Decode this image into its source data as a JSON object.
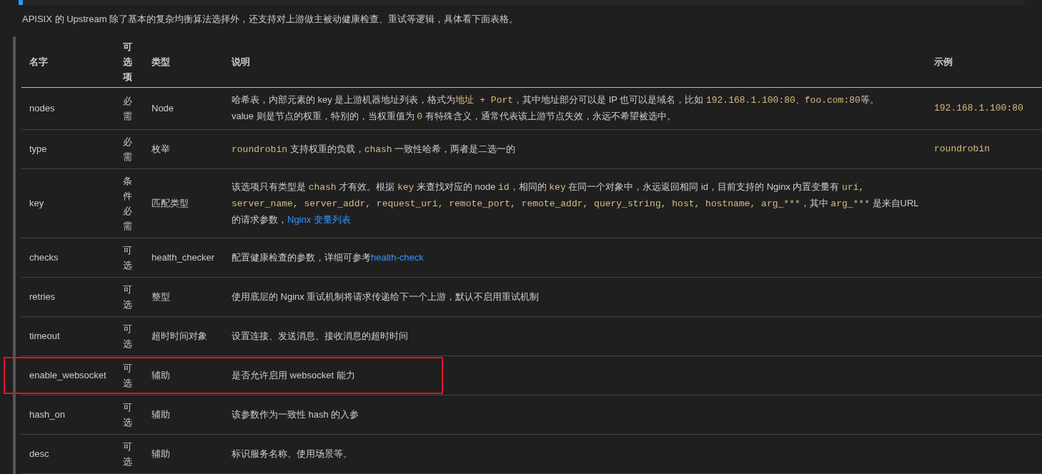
{
  "intro": "APISIX 的 Upstream 除了基本的复杂均衡算法选择外，还支持对上游做主被动健康检查、重试等逻辑，具体看下面表格。",
  "table": {
    "columns": [
      "名字",
      "可选项",
      "类型",
      "说明",
      "示例"
    ],
    "rows": [
      {
        "name": "nodes",
        "option": "必需",
        "type": "Node",
        "highlighted": false,
        "description": [
          [
            {
              "kind": "text",
              "text": "哈希表，内部元素的 key 是上游机器地址列表，格式为"
            },
            {
              "kind": "code",
              "text": "地址 + Port"
            },
            {
              "kind": "text",
              "text": "，其中地址部分可以是 IP 也可以是域名，比如 "
            },
            {
              "kind": "code",
              "text": "192.168.1.100:80"
            },
            {
              "kind": "text",
              "text": "、"
            },
            {
              "kind": "code",
              "text": "foo.com:80"
            },
            {
              "kind": "text",
              "text": "等。"
            }
          ],
          [
            {
              "kind": "text",
              "text": "value 则是节点的权重，特别的，当权重值为 "
            },
            {
              "kind": "code",
              "text": "0"
            },
            {
              "kind": "text",
              "text": " 有特殊含义，通常代表该上游节点失效，永远不希望被选中。"
            }
          ]
        ],
        "example": "192.168.1.100:80"
      },
      {
        "name": "type",
        "option": "必需",
        "type": "枚举",
        "highlighted": false,
        "description": [
          [
            {
              "kind": "code",
              "text": "roundrobin"
            },
            {
              "kind": "text",
              "text": " 支持权重的负载，"
            },
            {
              "kind": "code",
              "text": "chash"
            },
            {
              "kind": "text",
              "text": " 一致性哈希，两者是二选一的"
            }
          ]
        ],
        "example": "roundrobin"
      },
      {
        "name": "key",
        "option": "条件必需",
        "type": "匹配类型",
        "highlighted": false,
        "description": [
          [
            {
              "kind": "text",
              "text": "该选项只有类型是 "
            },
            {
              "kind": "code",
              "text": "chash"
            },
            {
              "kind": "text",
              "text": " 才有效。根据 "
            },
            {
              "kind": "code",
              "text": "key"
            },
            {
              "kind": "text",
              "text": " 来查找对应的 node "
            },
            {
              "kind": "code",
              "text": "id"
            },
            {
              "kind": "text",
              "text": "，相同的 "
            },
            {
              "kind": "code",
              "text": "key"
            },
            {
              "kind": "text",
              "text": " 在同一个对象中，永远返回相同 id，目前支持的 Nginx 内置变量有 "
            },
            {
              "kind": "code",
              "text": "uri,"
            }
          ],
          [
            {
              "kind": "code",
              "text": "server_name, server_addr, request_uri, remote_port, remote_addr, query_string, host, hostname, arg_***"
            },
            {
              "kind": "text",
              "text": "，其中 "
            },
            {
              "kind": "code",
              "text": "arg_***"
            },
            {
              "kind": "text",
              "text": " 是来自URL"
            }
          ],
          [
            {
              "kind": "text",
              "text": "的请求参数，"
            },
            {
              "kind": "link",
              "text": "Nginx 变量列表"
            }
          ]
        ]
      },
      {
        "name": "checks",
        "option": "可选",
        "type": "health_checker",
        "highlighted": false,
        "description": [
          [
            {
              "kind": "text",
              "text": "配置健康检查的参数，详细可参考"
            },
            {
              "kind": "link",
              "text": "health-check"
            }
          ]
        ]
      },
      {
        "name": "retries",
        "option": "可选",
        "type": "整型",
        "highlighted": false,
        "description": [
          [
            {
              "kind": "text",
              "text": "使用底层的 Nginx 重试机制将请求传递给下一个上游，默认不启用重试机制"
            }
          ]
        ]
      },
      {
        "name": "timeout",
        "option": "可选",
        "type": "超时时间对象",
        "highlighted": false,
        "description": [
          [
            {
              "kind": "text",
              "text": "设置连接、发送消息、接收消息的超时时间"
            }
          ]
        ]
      },
      {
        "name": "enable_websocket",
        "option": "可选",
        "type": "辅助",
        "highlighted": true,
        "description": [
          [
            {
              "kind": "text",
              "text": "是否允许启用 websocket 能力"
            }
          ]
        ]
      },
      {
        "name": "hash_on",
        "option": "可选",
        "type": "辅助",
        "highlighted": false,
        "description": [
          [
            {
              "kind": "text",
              "text": "该参数作为一致性 hash 的入参"
            }
          ]
        ]
      },
      {
        "name": "desc",
        "option": "可选",
        "type": "辅助",
        "highlighted": false,
        "description": [
          [
            {
              "kind": "text",
              "text": "标识服务名称、使用场景等。"
            }
          ]
        ]
      }
    ]
  }
}
